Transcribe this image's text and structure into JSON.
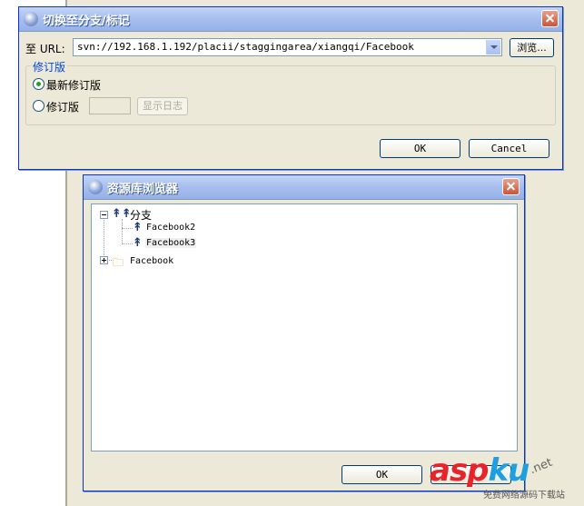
{
  "switch_dialog": {
    "title": "切换至分支/标记",
    "url_label": "至 URL:",
    "url_value": "svn://192.168.1.192/placii/staggingarea/xiangqi/Facebook",
    "browse_label": "浏览...",
    "revision_group_title": "修订版",
    "radio_latest_label": "最新修订版",
    "radio_revision_label": "修订版",
    "revision_value": "",
    "show_log_label": "显示日志",
    "ok_label": "OK",
    "cancel_label": "Cancel"
  },
  "repo_browser": {
    "title": "资源库浏览器",
    "tree": {
      "branches_label": "分支",
      "children": [
        "Facebook2",
        "Facebook3"
      ],
      "folder_label": "Facebook"
    },
    "ok_label": "OK"
  },
  "watermark": {
    "part1": "asp",
    "part2": "ku",
    "net": ".net",
    "subtitle": "免费网络源码下载站"
  }
}
